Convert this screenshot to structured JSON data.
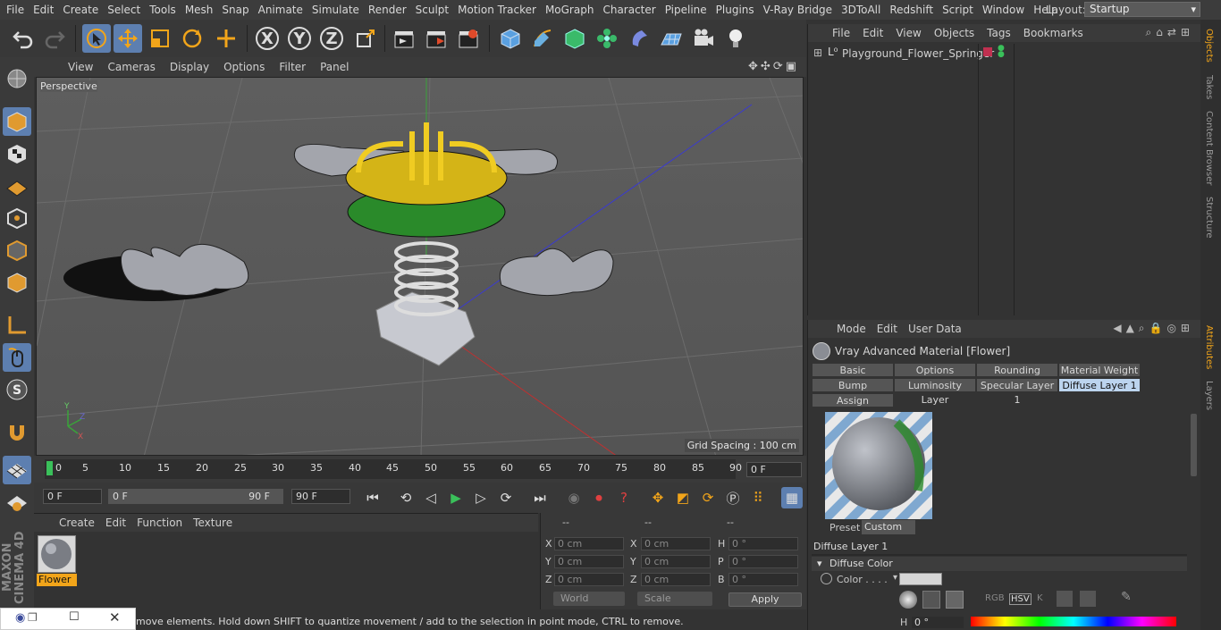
{
  "menubar": {
    "items": [
      "File",
      "Edit",
      "Create",
      "Select",
      "Tools",
      "Mesh",
      "Snap",
      "Animate",
      "Simulate",
      "Render",
      "Sculpt",
      "Motion Tracker",
      "MoGraph",
      "Character",
      "Pipeline",
      "Plugins",
      "V-Ray Bridge",
      "3DToAll",
      "Redshift",
      "Script",
      "Window",
      "Help"
    ],
    "layout_label": "Layout:",
    "layout_value": "Startup"
  },
  "toolbar": {
    "axis_x": "X",
    "axis_y": "Y",
    "axis_z": "Z"
  },
  "viewport": {
    "menu": [
      "View",
      "Cameras",
      "Display",
      "Options",
      "Filter",
      "Panel"
    ],
    "label": "Perspective",
    "grid_spacing": "Grid Spacing : 100 cm"
  },
  "timeline": {
    "ticks": [
      "0",
      "5",
      "10",
      "15",
      "20",
      "25",
      "30",
      "35",
      "40",
      "45",
      "50",
      "55",
      "60",
      "65",
      "70",
      "75",
      "80",
      "85",
      "90"
    ],
    "current_frame": "0 F"
  },
  "transport": {
    "start": "0 F",
    "range_start": "0 F",
    "range_end": "90 F",
    "end": "90 F"
  },
  "material_manager": {
    "menu": [
      "Create",
      "Edit",
      "Function",
      "Texture"
    ],
    "material_name": "Flower",
    "brand": "MAXON CINEMA 4D"
  },
  "coordinates": {
    "headers": [
      "--",
      "--",
      "--"
    ],
    "rows": [
      {
        "l1": "X",
        "v1": "0 cm",
        "l2": "X",
        "v2": "0 cm",
        "l3": "H",
        "v3": "0 °"
      },
      {
        "l1": "Y",
        "v1": "0 cm",
        "l2": "Y",
        "v2": "0 cm",
        "l3": "P",
        "v3": "0 °"
      },
      {
        "l1": "Z",
        "v1": "0 cm",
        "l2": "Z",
        "v2": "0 cm",
        "l3": "B",
        "v3": "0 °"
      }
    ],
    "space": "World",
    "mode": "Scale",
    "apply": "Apply"
  },
  "status": {
    "text": "move elements. Hold down SHIFT to quantize movement / add to the selection in point mode, CTRL to remove."
  },
  "objects": {
    "menu": [
      "File",
      "Edit",
      "View",
      "Objects",
      "Tags",
      "Bookmarks"
    ],
    "item_name": "Playground_Flower_Springer"
  },
  "attributes": {
    "menu": [
      "Mode",
      "Edit",
      "User Data"
    ],
    "title": "Vray Advanced Material [Flower]",
    "tabs_row1": [
      "Basic",
      "Options",
      "Rounding",
      "Material Weight"
    ],
    "tabs_row2": [
      "Bump",
      "Luminosity Layer",
      "Specular Layer 1",
      "Diffuse Layer 1"
    ],
    "tab_assign": "Assign",
    "preset_label": "Preset",
    "preset_value": "Custom",
    "section": "Diffuse Layer 1",
    "group": "Diffuse Color",
    "color_label": "Color . . . .",
    "h_label": "H",
    "h_value": "0 °",
    "modes": [
      "RGB",
      "HSV",
      "K"
    ]
  },
  "side_tabs": [
    "Objects",
    "Takes",
    "Content Browser",
    "Structure",
    "Attributes",
    "Layers"
  ]
}
